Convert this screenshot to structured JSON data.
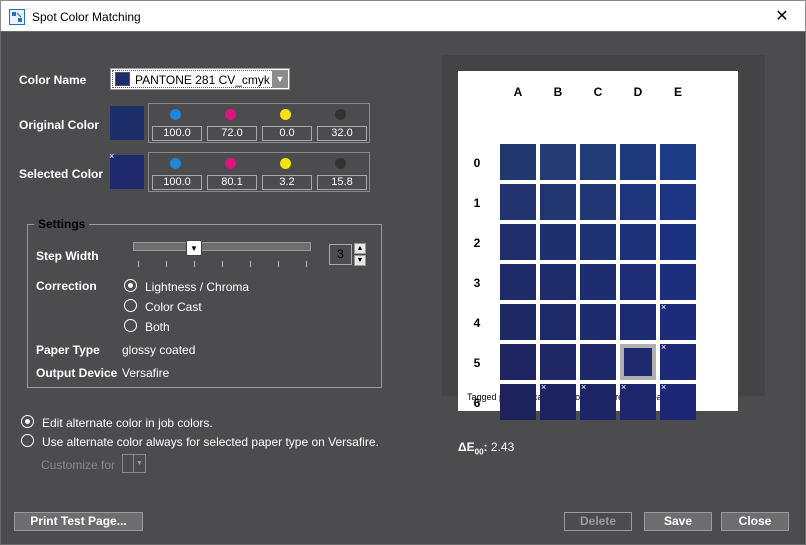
{
  "window": {
    "title": "Spot Color Matching",
    "close_glyph": "✕",
    "icon": "spot-color-app-icon"
  },
  "labels": {
    "color_name": "Color Name",
    "original_color": "Original Color",
    "selected_color": "Selected Color",
    "settings": "Settings",
    "step_width": "Step Width",
    "correction": "Correction",
    "paper_type": "Paper Type",
    "output_device": "Output Device"
  },
  "color_name": {
    "value": "PANTONE 281 CV_cmyk",
    "swatch_color": "#1d2e6b"
  },
  "original_color": {
    "swatch_color": "#1d2e6b",
    "cmyk": [
      "100.0",
      "72.0",
      "0.0",
      "32.0"
    ]
  },
  "selected_color": {
    "swatch_color": "#1f2a6e",
    "cmyk": [
      "100.0",
      "80.1",
      "3.2",
      "15.8"
    ],
    "tag": "×"
  },
  "ink_colors": {
    "cyan": "#1e88d6",
    "magenta": "#e0127f",
    "yellow": "#f3e312",
    "black": "#333333"
  },
  "settings": {
    "step_width_value": "3",
    "correction_options": [
      "Lightness / Chroma",
      "Color Cast",
      "Both"
    ],
    "correction_selected": 0,
    "paper_type_value": "glossy coated",
    "output_device_value": "Versafire"
  },
  "alternate": {
    "options": [
      "Edit alternate color in job colors.",
      "Use alternate color always for selected paper type on Versafire."
    ],
    "selected": 0,
    "customize_for_label": "Customize for"
  },
  "grid": {
    "columns": [
      "A",
      "B",
      "C",
      "D",
      "E"
    ],
    "rows": [
      "0",
      "1",
      "2",
      "3",
      "4",
      "5",
      "6"
    ],
    "tag_glyph": "×",
    "colors": [
      [
        "#22366e",
        "#233a72",
        "#213b76",
        "#1f3a7c",
        "#1d3a84"
      ],
      [
        "#223370",
        "#213571",
        "#203675",
        "#1e357b",
        "#1c3482"
      ],
      [
        "#202e6c",
        "#1f306f",
        "#1e3173",
        "#1d3279",
        "#1c3280"
      ],
      [
        "#1f2b68",
        "#1e2c6b",
        "#1d2d6f",
        "#1d2e76",
        "#1c2f7d"
      ],
      [
        "#1e2864",
        "#1e2967",
        "#1d2a6c",
        "#1d2b72",
        "#1c2c7a"
      ],
      [
        "#1e2560",
        "#1e2663",
        "#1d2769",
        "#1f2a6e",
        "#1c2977"
      ],
      [
        "#1d225c",
        "#1d2360",
        "#1d2466",
        "#1d256c",
        "#1c2674"
      ]
    ],
    "tagged": [
      [
        4,
        4
      ],
      [
        5,
        4
      ],
      [
        6,
        1
      ],
      [
        6,
        2
      ],
      [
        6,
        3
      ],
      [
        6,
        4
      ]
    ],
    "selected": [
      5,
      3
    ],
    "note": "Tagged patches cannot be output correctly on paper."
  },
  "delta_e": {
    "symbol": "ΔE",
    "subscript": "00",
    "suffix": ":",
    "value": "2.43"
  },
  "buttons": {
    "print_test_page": "Print Test Page...",
    "delete": "Delete",
    "save": "Save",
    "close": "Close"
  }
}
